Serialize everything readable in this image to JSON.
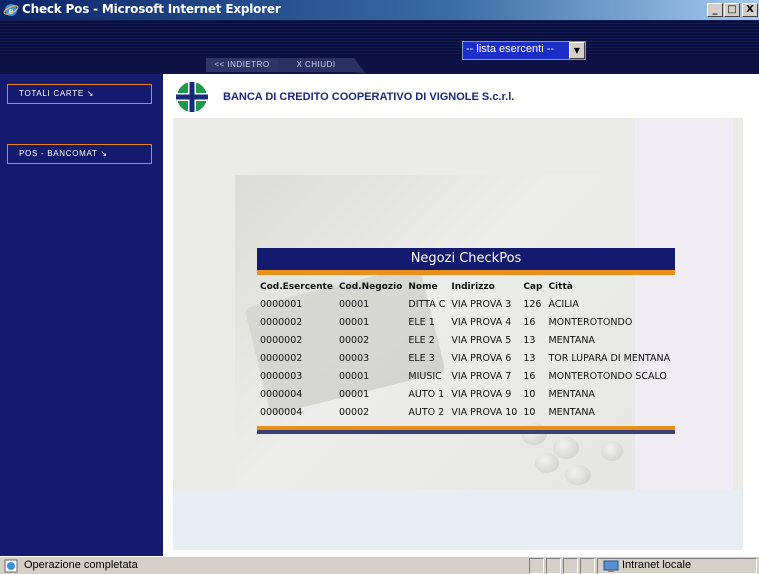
{
  "window": {
    "title": "Check Pos - Microsoft Internet Explorer",
    "controls": [
      "_",
      "□",
      "X"
    ]
  },
  "toolbar": {
    "dropdown_value": "-- lista esercenti --",
    "tab_back": "<< INDIETRO",
    "tab_close": "X  CHIUDI"
  },
  "sidebar": {
    "items": [
      {
        "label": "TOTALI CARTE  ↘"
      },
      {
        "label": "POS - BANCOMAT  ↘"
      }
    ]
  },
  "brand": {
    "name": "BANCA DI CREDITO COOPERATIVO DI VIGNOLE S.c.r.l.",
    "color_primary": "#141a6e",
    "color_accent": "#e8901c",
    "color_logo_green": "#1f9a4a"
  },
  "table": {
    "title": "Negozi CheckPos",
    "columns": [
      "Cod.Esercente",
      "Cod.Negozio",
      "Nome",
      "Indirizzo",
      "Cap",
      "Città"
    ],
    "rows": [
      [
        "0000001",
        "00001",
        "DITTA C",
        "VIA PROVA 3",
        "126",
        "ACILIA"
      ],
      [
        "0000002",
        "00001",
        "ELE 1",
        "VIA PROVA 4",
        "16",
        "MONTEROTONDO"
      ],
      [
        "0000002",
        "00002",
        "ELE 2",
        "VIA PROVA 5",
        "13",
        "MENTANA"
      ],
      [
        "0000002",
        "00003",
        "ELE 3",
        "VIA PROVA 6",
        "13",
        "TOR LUPARA DI MENTANA"
      ],
      [
        "0000003",
        "00001",
        "MIUSIC",
        "VIA PROVA 7",
        "16",
        "MONTEROTONDO SCALO"
      ],
      [
        "0000004",
        "00001",
        "AUTO 1",
        "VIA PROVA 9",
        "10",
        "MENTANA"
      ],
      [
        "0000004",
        "00002",
        "AUTO 2",
        "VIA PROVA 10",
        "10",
        "MENTANA"
      ]
    ]
  },
  "statusbar": {
    "text": "Operazione completata",
    "zone": "Intranet locale"
  }
}
